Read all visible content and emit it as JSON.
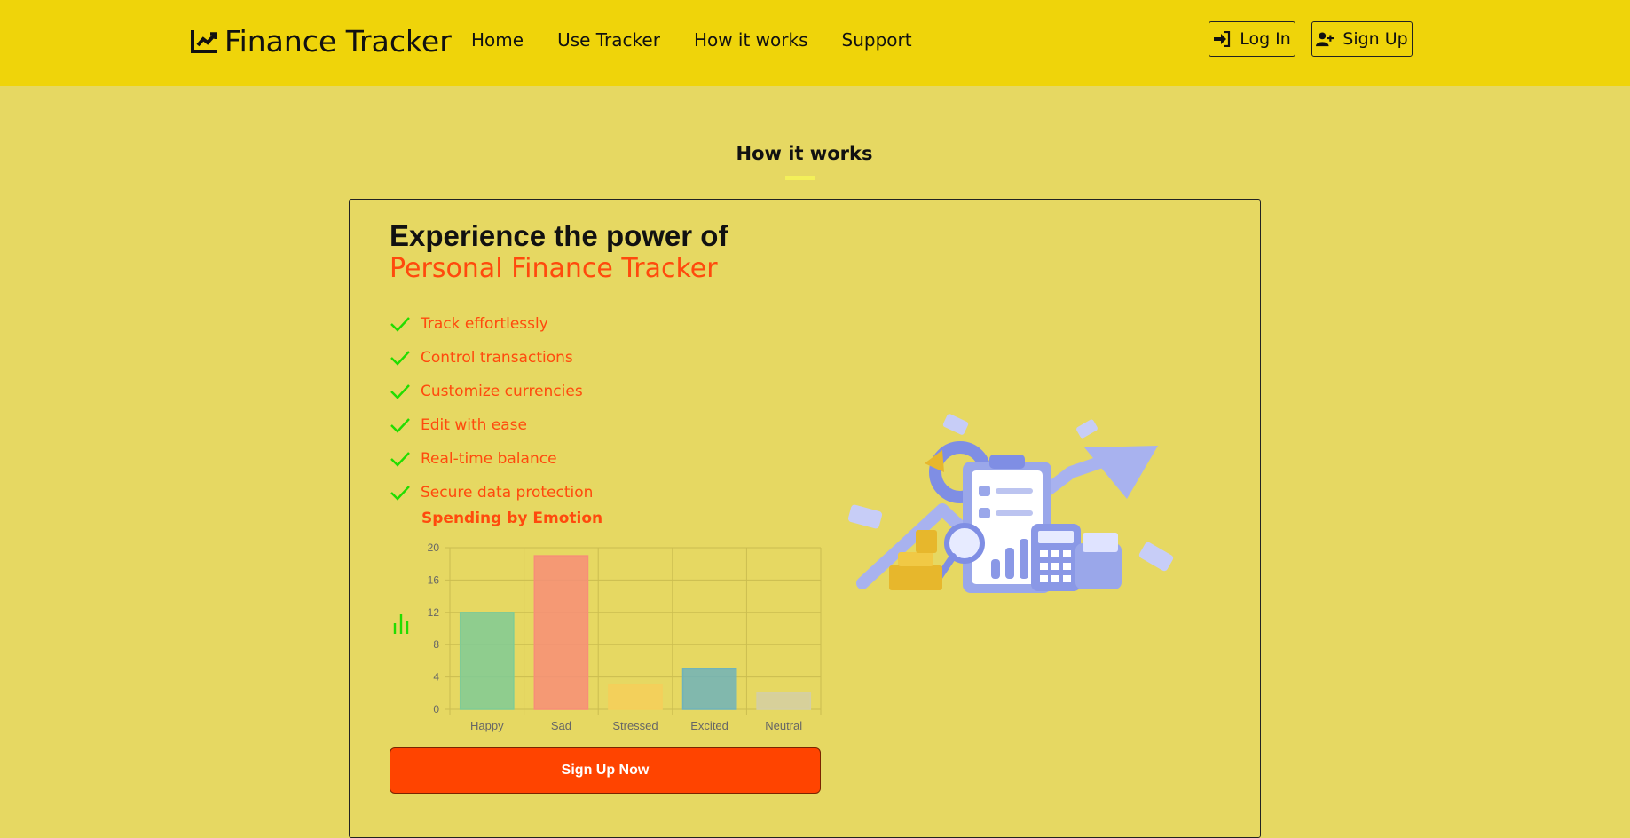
{
  "nav": {
    "brand": "Finance Tracker",
    "links": [
      "Home",
      "Use Tracker",
      "How it works",
      "Support"
    ],
    "login": "Log In",
    "signup": "Sign Up"
  },
  "section": {
    "title": "How it works"
  },
  "hero": {
    "headline": "Experience the power of",
    "accent": "Personal Finance Tracker",
    "features": [
      "Track effortlessly",
      "Control transactions",
      "Customize currencies",
      "Edit with ease",
      "Real-time balance",
      "Secure data protection"
    ],
    "cta": "Sign Up Now"
  },
  "colors": {
    "navbar": "#efd40a",
    "background": "#e6d862",
    "accent": "#ff4a0d",
    "check": "#22dd00",
    "button": "#ff4400"
  },
  "chart_data": {
    "type": "bar",
    "title": "Spending by Emotion",
    "categories": [
      "Happy",
      "Sad",
      "Stressed",
      "Excited",
      "Neutral"
    ],
    "values": [
      12,
      19,
      3,
      5,
      2
    ],
    "colors": [
      "#7fcb96",
      "#f78e78",
      "#f4cf5a",
      "#6fb3bb",
      "#d4cfa4"
    ],
    "ylim": [
      0,
      20
    ],
    "yticks": [
      0,
      4,
      8,
      12,
      16,
      20
    ],
    "grid": true
  }
}
